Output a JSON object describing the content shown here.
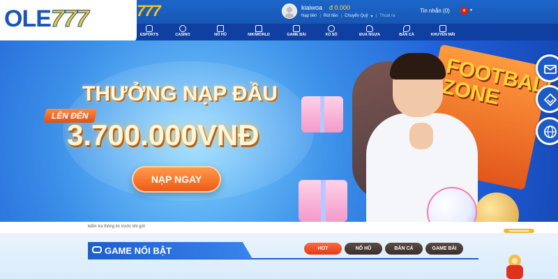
{
  "header": {
    "logo": "OLE777",
    "logo_small": "777",
    "user": {
      "name": "kiaiwoa",
      "balance": "đ 0.000",
      "links": [
        "Nạp tiền",
        "Rút tiền",
        "Chuyển Quỹ",
        "Thoát ra"
      ]
    },
    "messages_label": "Tin nhắn (0)",
    "flag_icon": "vietnam-flag-icon"
  },
  "nav": [
    {
      "label": "ESPORTS",
      "icon": "gamepad-icon"
    },
    {
      "label": "CASINO",
      "icon": "casino-chip-icon"
    },
    {
      "label": "NỔ HŨ",
      "icon": "slot-icon"
    },
    {
      "label": "NIKIWORLD",
      "icon": "crown-icon"
    },
    {
      "label": "GAME BÀI",
      "icon": "cards-icon"
    },
    {
      "label": "XỔ SỐ",
      "icon": "lottery-icon"
    },
    {
      "label": "ĐUA NGỰA",
      "icon": "horse-icon"
    },
    {
      "label": "BẮN CÁ",
      "icon": "fish-icon"
    },
    {
      "label": "KHUYẾN MÃI",
      "icon": "gift-icon"
    }
  ],
  "banner": {
    "title": "THƯỞNG NẠP ĐẦU",
    "sub": "LÊN ĐẾN",
    "amount": "3.700.000VNĐ",
    "cta": "NẠP NGAY",
    "poster_text": "FOOTBALL ZONE",
    "slides": 6,
    "active_slide": 0
  },
  "ticker": {
    "text": "kiểm tra thông tin trước khi gửi"
  },
  "featured": {
    "title": "GAME NỔI BẬT",
    "tabs": [
      "HOT",
      "NỔ HŨ",
      "BẮN CÁ",
      "GAME BÀI"
    ],
    "active_tab": 0
  },
  "colors": {
    "primary": "#1c66c9",
    "nav": "#0f3fa0",
    "accent": "#f6c21c",
    "hot_tab": "#e0391c"
  }
}
